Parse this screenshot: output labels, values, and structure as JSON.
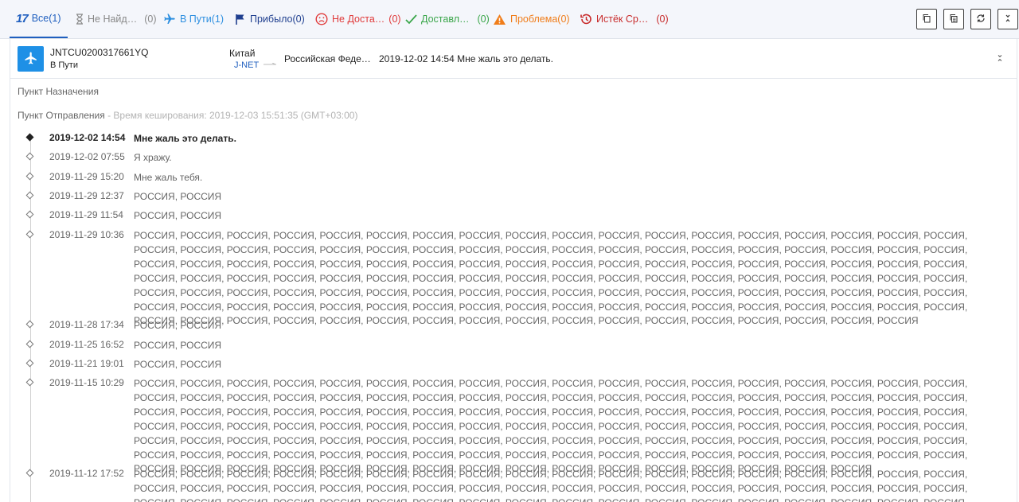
{
  "tabs": [
    {
      "label": "Все(1)",
      "icon": "logo-17",
      "color": "#1f5fbf"
    },
    {
      "label": "Не Найд…",
      "count": "(0)",
      "icon": "hourglass-icon",
      "color": "#888888"
    },
    {
      "label": "В Пути(1)",
      "icon": "plane-icon",
      "color": "#2d8fe0"
    },
    {
      "label": "Прибыло(0)",
      "icon": "flag-icon",
      "color": "#1f3f8f"
    },
    {
      "label": "Не Доста…",
      "count": "(0)",
      "icon": "sad-face-icon",
      "color": "#e03a3a"
    },
    {
      "label": "Доставл…",
      "count": "(0)",
      "icon": "check-icon",
      "color": "#3aa64a"
    },
    {
      "label": "Проблема(0)",
      "icon": "warning-icon",
      "color": "#f07d1a"
    },
    {
      "label": "Истёк Ср…",
      "count": "(0)",
      "icon": "history-icon",
      "color": "#c82b2b"
    }
  ],
  "logo_text": "17",
  "toolbar": [
    "copy-icon",
    "copy-all-icon",
    "refresh-icon",
    "collapse-icon"
  ],
  "shipment": {
    "number": "JNTCU0200317661YQ",
    "status": "В Пути",
    "origin": "Китай",
    "carrier": "J-NET",
    "destination": "Российская Феде…",
    "last_event": "2019-12-02 14:54  Мне жаль это делать."
  },
  "details": {
    "destination_label": "Пункт Назначения",
    "origin_label": "Пункт Отправления",
    "cache_note": " - Время кеширования: 2019-12-03 15:51:35 (GMT+03:00)"
  },
  "events": [
    {
      "time": "2019-12-02 14:54",
      "desc": "Мне жаль это делать."
    },
    {
      "time": "2019-12-02 07:55",
      "desc": "Я хражу."
    },
    {
      "time": "2019-11-29 15:20",
      "desc": "Мне жаль тебя."
    },
    {
      "time": "2019-11-29 12:37",
      "desc": "РОССИЯ, РОССИЯ"
    },
    {
      "time": "2019-11-29 11:54",
      "desc": "РОССИЯ, РОССИЯ"
    },
    {
      "time": "2019-11-29 10:36",
      "desc": "РОССИЯ, РОССИЯ, РОССИЯ, РОССИЯ, РОССИЯ, РОССИЯ, РОССИЯ, РОССИЯ, РОССИЯ, РОССИЯ, РОССИЯ, РОССИЯ, РОССИЯ, РОССИЯ, РОССИЯ, РОССИЯ, РОССИЯ, РОССИЯ, РОССИЯ, РОССИЯ, РОССИЯ, РОССИЯ, РОССИЯ, РОССИЯ, РОССИЯ, РОССИЯ, РОССИЯ, РОССИЯ, РОССИЯ, РОССИЯ, РОССИЯ, РОССИЯ, РОССИЯ, РОССИЯ, РОССИЯ, РОССИЯ, РОССИЯ, РОССИЯ, РОССИЯ, РОССИЯ, РОССИЯ, РОССИЯ, РОССИЯ, РОССИЯ, РОССИЯ, РОССИЯ, РОССИЯ, РОССИЯ, РОССИЯ, РОССИЯ, РОССИЯ, РОССИЯ, РОССИЯ, РОССИЯ, РОССИЯ, РОССИЯ, РОССИЯ, РОССИЯ, РОССИЯ, РОССИЯ, РОССИЯ, РОССИЯ, РОССИЯ, РОССИЯ, РОССИЯ, РОССИЯ, РОССИЯ, РОССИЯ, РОССИЯ, РОССИЯ, РОССИЯ, РОССИЯ, РОССИЯ, РОССИЯ, РОССИЯ, РОССИЯ, РОССИЯ, РОССИЯ, РОССИЯ, РОССИЯ, РОССИЯ, РОССИЯ, РОССИЯ, РОССИЯ, РОССИЯ, РОССИЯ, РОССИЯ, РОССИЯ, РОССИЯ, РОССИЯ, РОССИЯ, РОССИЯ, РОССИЯ, РОССИЯ, РОССИЯ, РОССИЯ, РОССИЯ, РОССИЯ, РОССИЯ, РОССИЯ, РОССИЯ, РОССИЯ, РОССИЯ, РОССИЯ, РОССИЯ, РОССИЯ, РОССИЯ, РОССИЯ, РОССИЯ, РОССИЯ, РОССИЯ, РОССИЯ, РОССИЯ, РОССИЯ, РОССИЯ, РОССИЯ, РОССИЯ, РОССИЯ, РОССИЯ, РОССИЯ, РОССИЯ, РОССИЯ, РОССИЯ, РОССИЯ, РОССИЯ"
    },
    {
      "time": "2019-11-28 17:34",
      "desc": "РОССИЯ, РОССИЯ"
    },
    {
      "time": "2019-11-25 16:52",
      "desc": "РОССИЯ, РОССИЯ"
    },
    {
      "time": "2019-11-21 19:01",
      "desc": "РОССИЯ, РОССИЯ"
    },
    {
      "time": "2019-11-15 10:29",
      "desc": "РОССИЯ, РОССИЯ, РОССИЯ, РОССИЯ, РОССИЯ, РОССИЯ, РОССИЯ, РОССИЯ, РОССИЯ, РОССИЯ, РОССИЯ, РОССИЯ, РОССИЯ, РОССИЯ, РОССИЯ, РОССИЯ, РОССИЯ, РОССИЯ, РОССИЯ, РОССИЯ, РОССИЯ, РОССИЯ, РОССИЯ, РОССИЯ, РОССИЯ, РОССИЯ, РОССИЯ, РОССИЯ, РОССИЯ, РОССИЯ, РОССИЯ, РОССИЯ, РОССИЯ, РОССИЯ, РОССИЯ, РОССИЯ, РОССИЯ, РОССИЯ, РОССИЯ, РОССИЯ, РОССИЯ, РОССИЯ, РОССИЯ, РОССИЯ, РОССИЯ, РОССИЯ, РОССИЯ, РОССИЯ, РОССИЯ, РОССИЯ, РОССИЯ, РОССИЯ, РОССИЯ, РОССИЯ, РОССИЯ, РОССИЯ, РОССИЯ, РОССИЯ, РОССИЯ, РОССИЯ, РОССИЯ, РОССИЯ, РОССИЯ, РОССИЯ, РОССИЯ, РОССИЯ, РОССИЯ, РОССИЯ, РОССИЯ, РОССИЯ, РОССИЯ, РОССИЯ, РОССИЯ, РОССИЯ, РОССИЯ, РОССИЯ, РОССИЯ, РОССИЯ, РОССИЯ, РОССИЯ, РОССИЯ, РОССИЯ, РОССИЯ, РОССИЯ, РОССИЯ, РОССИЯ, РОССИЯ, РОССИЯ, РОССИЯ, РОССИЯ, РОССИЯ, РОССИЯ, РОССИЯ, РОССИЯ, РОССИЯ, РОССИЯ, РОССИЯ, РОССИЯ, РОССИЯ, РОССИЯ, РОССИЯ, РОССИЯ, РОССИЯ, РОССИЯ, РОССИЯ, РОССИЯ, РОССИЯ, РОССИЯ, РОССИЯ, РОССИЯ, РОССИЯ, РОССИЯ, РОССИЯ, РОССИЯ, РОССИЯ, РОССИЯ, РОССИЯ, РОССИЯ, РОССИЯ, РОССИЯ, РОССИЯ, РОССИЯ, РОССИЯ, РОССИЯ"
    },
    {
      "time": "2019-11-12 17:52",
      "desc": "РОССИЯ, РОССИЯ, РОССИЯ, РОССИЯ, РОССИЯ, РОССИЯ, РОССИЯ, РОССИЯ, РОССИЯ, РОССИЯ, РОССИЯ, РОССИЯ, РОССИЯ, РОССИЯ, РОССИЯ, РОССИЯ, РОССИЯ, РОССИЯ, РОССИЯ, РОССИЯ, РОССИЯ, РОССИЯ, РОССИЯ, РОССИЯ, РОССИЯ, РОССИЯ, РОССИЯ, РОССИЯ, РОССИЯ, РОССИЯ, РОССИЯ, РОССИЯ, РОССИЯ, РОССИЯ, РОССИЯ, РОССИЯ, РОССИЯ, РОССИЯ, РОССИЯ, РОССИЯ, РОССИЯ, РОССИЯ, РОССИЯ, РОССИЯ, РОССИЯ, РОССИЯ, РОССИЯ, РОССИЯ, РОССИЯ, РОССИЯ, РОССИЯ, РОССИЯ, РОССИЯ, РОССИЯ, РОССИЯ, РОССИЯ, РОССИЯ, РОССИЯ, РОССИЯ, РОССИЯ, РОССИЯ, РОССИЯ, РОССИЯ, РОССИЯ, РОССИЯ, РОССИЯ, РОССИЯ, РОССИЯ, РОССИЯ, РОССИЯ"
    }
  ]
}
